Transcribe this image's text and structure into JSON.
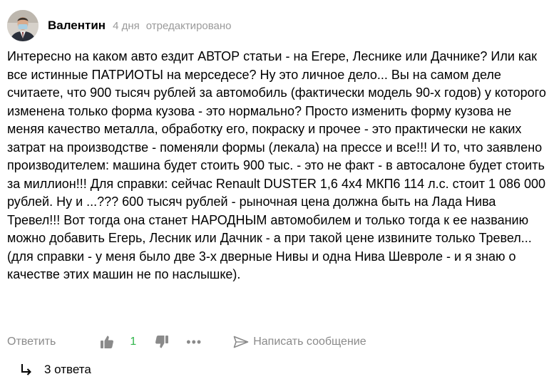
{
  "comment": {
    "author": "Валентин",
    "time": "4 дня",
    "edited": "отредактировано",
    "text": "Интересно на каком авто ездит АВТОР статьи - на Егере, Леснике или Дачнике? Или как все истинные ПАТРИОТЫ на мерседесе? Ну это личное дело... Вы на самом деле считаете, что 900 тысяч рублей за автомобиль (фактически модель 90-х годов) у которого изменена только форма кузова - это нормально? Просто изменить форму кузова не меняя качество металла, обработку его, покраску и прочее - это практически не каких затрат на производстве - поменяли формы (лекала) на прессе и все!!! И то, что заявлено производителем: машина будет стоить 900 тыс. - это не факт - в автосалоне будет стоить за миллион!!! Для справки: сейчас Renault DUSTER 1,6 4x4 МКП6 114 л.с. стоит 1 086 000 рублей. Ну и ...??? 600 тысяч рублей - рыночная цена должна быть на Лада Нива Тревел!!! Вот тогда она станет НАРОДНЫМ автомобилем и только тогда к ее названию можно добавить Егерь, Лесник или Дачник - а при такой цене извините только Тревел... (для справки - у меня было две 3-х дверные Нивы и одна Нива Шевроле - и я знаю о качестве этих машин не по наслышке)."
  },
  "actions": {
    "reply_label": "Ответить",
    "like_count": "1",
    "more_label": "•••",
    "message_label": "Написать сообщение"
  },
  "replies": {
    "label": "3 ответа"
  },
  "colors": {
    "like_count": "#2fb54a",
    "muted": "#8a8a8a"
  },
  "icons": [
    "thumbs-up-icon",
    "thumbs-down-icon",
    "more-dots-icon",
    "send-message-icon",
    "reply-arrow-icon"
  ]
}
